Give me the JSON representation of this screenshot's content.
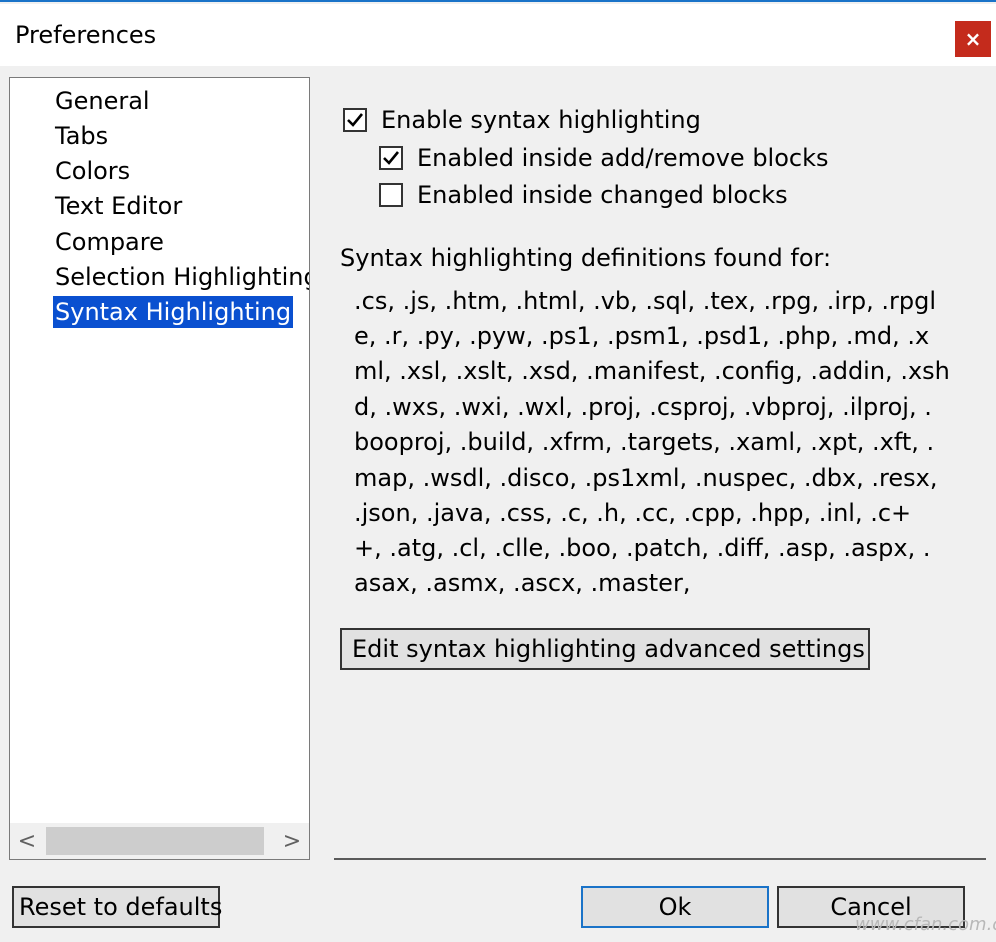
{
  "window": {
    "title": "Preferences",
    "close_label": "×"
  },
  "nav": {
    "items": [
      {
        "label": "General",
        "selected": false
      },
      {
        "label": "Tabs",
        "selected": false
      },
      {
        "label": "Colors",
        "selected": false
      },
      {
        "label": "Text Editor",
        "selected": false
      },
      {
        "label": "Compare",
        "selected": false
      },
      {
        "label": "Selection Highlighting",
        "selected": false
      },
      {
        "label": "Syntax Highlighting",
        "selected": true
      }
    ],
    "scroll_left": "<",
    "scroll_right": ">"
  },
  "options": {
    "enable_syntax": {
      "label": "Enable syntax highlighting",
      "checked": true
    },
    "inside_add_remove": {
      "label": "Enabled inside add/remove blocks",
      "checked": true
    },
    "inside_changed": {
      "label": "Enabled inside changed blocks",
      "checked": false
    }
  },
  "definitions": {
    "heading": "Syntax highlighting definitions found for:",
    "lines": [
      ".cs, .js, .htm, .html, .vb, .sql, .tex, .rpg, .irp, .rpgl",
      "e, .r, .py, .pyw, .ps1, .psm1, .psd1, .php, .md, .x",
      "ml, .xsl, .xslt, .xsd, .manifest, .config, .addin, .xsh",
      "d, .wxs, .wxi, .wxl, .proj, .csproj, .vbproj, .ilproj, .",
      "booproj, .build, .xfrm, .targets, .xaml, .xpt, .xft, .",
      "map, .wsdl, .disco, .ps1xml, .nuspec, .dbx, .resx,",
      " .json, .java, .css, .c, .h, .cc, .cpp, .hpp, .inl, .c+",
      "+, .atg, .cl, .clle, .boo, .patch, .diff, .asp, .aspx, .",
      "asax, .asmx, .ascx, .master,"
    ]
  },
  "buttons": {
    "advanced": "Edit syntax highlighting advanced settings",
    "reset": "Reset to defaults",
    "ok": "Ok",
    "cancel": "Cancel"
  },
  "watermark": "www.cfan.com.cn",
  "colors": {
    "selection": "#0a50d0",
    "close_button": "#c42b1c",
    "focus_border": "#1a73c8"
  }
}
